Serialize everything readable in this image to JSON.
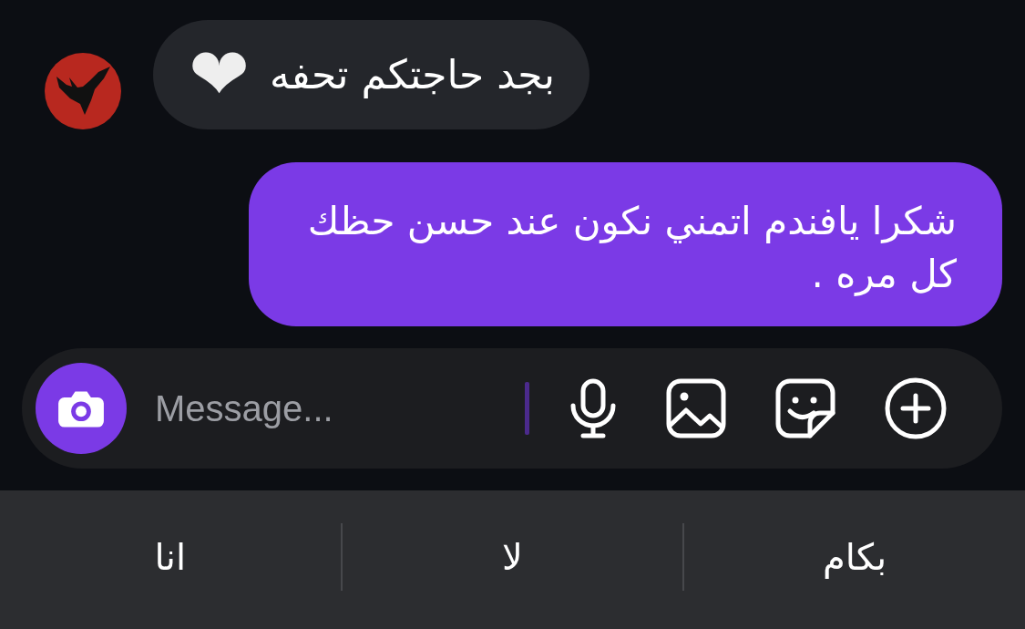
{
  "messages": [
    {
      "kind": "received",
      "text": "بجد حاجتكم تحفه",
      "emoji": "❤"
    },
    {
      "kind": "sent",
      "text": "شكرا يافندم اتمني نكون عند حسن حظك كل مره ."
    }
  ],
  "composer": {
    "placeholder": "Message..."
  },
  "suggestions": [
    {
      "text": "بكام"
    },
    {
      "text": "لا"
    },
    {
      "text": "انا"
    }
  ]
}
